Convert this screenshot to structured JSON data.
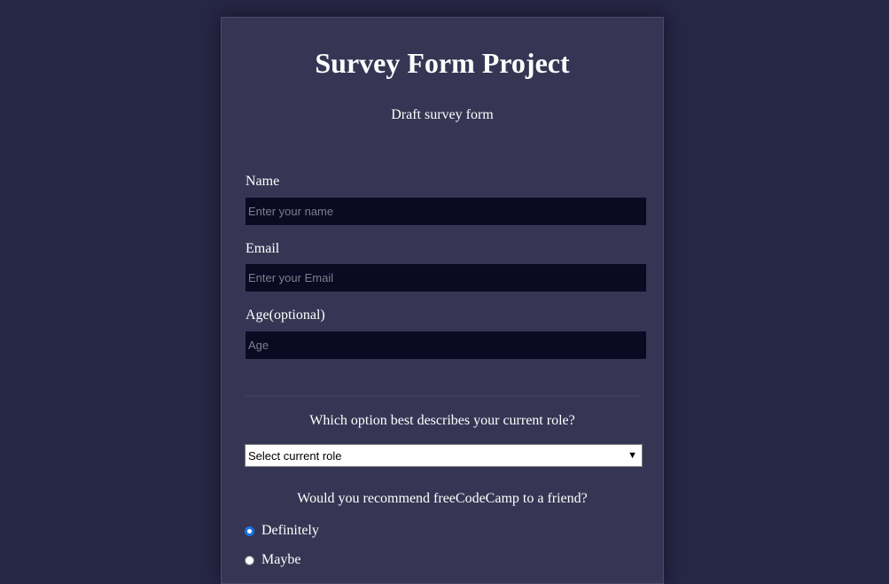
{
  "header": {
    "title": "Survey Form Project",
    "description": "Draft survey form"
  },
  "form": {
    "name": {
      "label": "Name",
      "placeholder": "Enter your name",
      "value": ""
    },
    "email": {
      "label": "Email",
      "placeholder": "Enter your Email",
      "value": ""
    },
    "age": {
      "label": "Age(optional)",
      "placeholder": "Age",
      "value": ""
    },
    "role": {
      "question": "Which option best describes your current role?",
      "selected": "Select current role"
    },
    "recommend": {
      "question": "Would you recommend freeCodeCamp to a friend?",
      "options": [
        {
          "label": "Definitely",
          "checked": true
        },
        {
          "label": "Maybe",
          "checked": false
        }
      ]
    }
  },
  "colors": {
    "page_background": "#262645",
    "card_background": "#363654",
    "input_background": "#0a0a23",
    "radio_accent": "#1a73e8"
  }
}
